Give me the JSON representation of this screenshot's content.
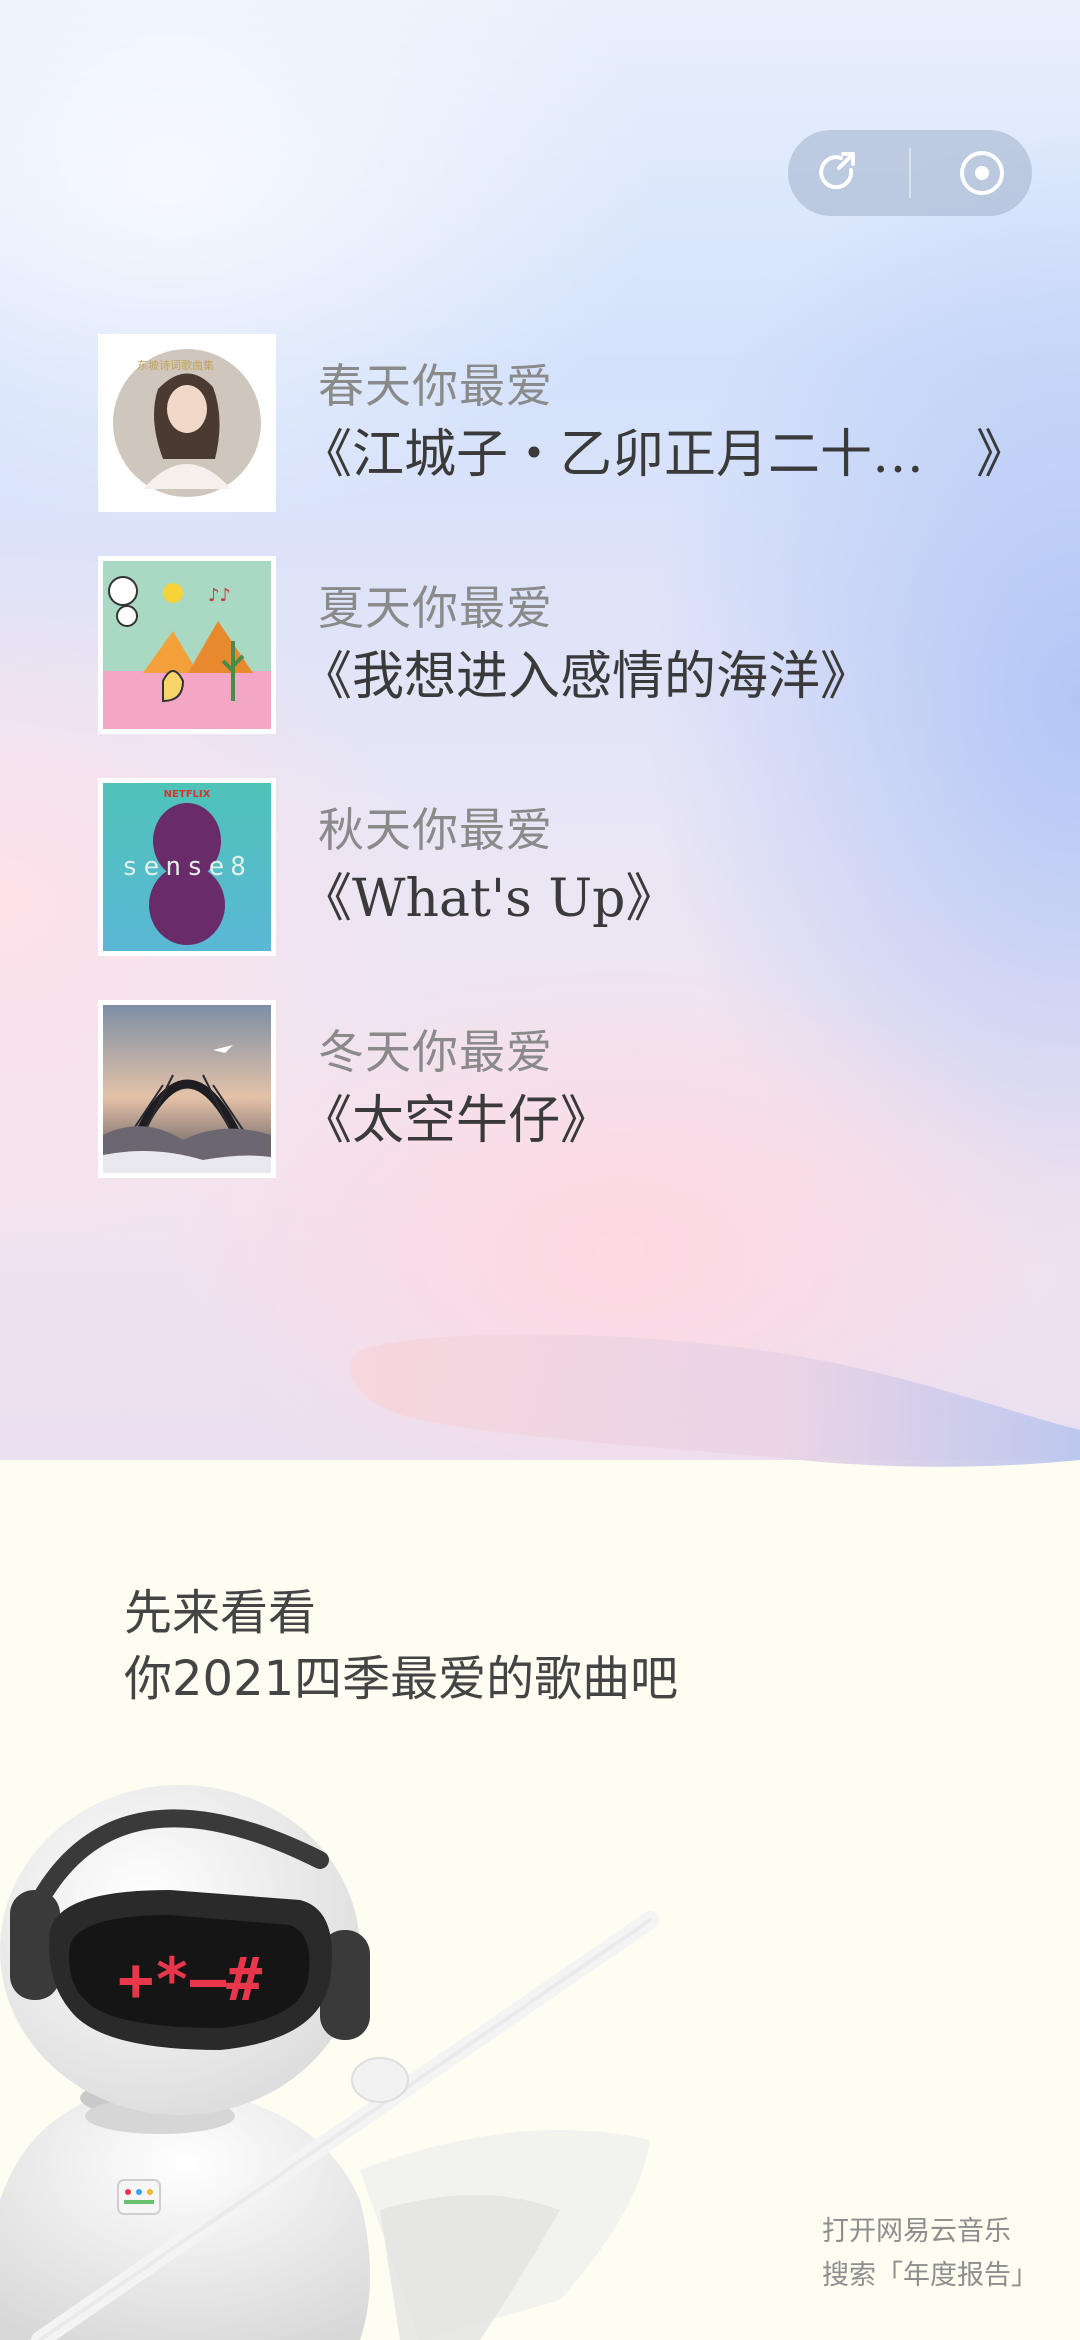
{
  "header": {
    "share_icon": "share-icon",
    "close_icon": "record-icon"
  },
  "songs": [
    {
      "season": "春天你最爱",
      "title": "《江城子・乙卯正月二十…　》",
      "cover_icon": "album-cover-spring"
    },
    {
      "season": "夏天你最爱",
      "title": "《我想进入感情的海洋》",
      "cover_icon": "album-cover-summer"
    },
    {
      "season": "秋天你最爱",
      "title": "《What's Up》",
      "cover_icon": "album-cover-autumn"
    },
    {
      "season": "冬天你最爱",
      "title": "《太空牛仔》",
      "cover_icon": "album-cover-winter"
    }
  ],
  "cover_text": {
    "spring_badge": "东坡诗词歌曲集",
    "autumn_label": "NETFLIX",
    "autumn_word": "sense8"
  },
  "intro": {
    "line1": "先来看看",
    "line2": "你2021四季最爱的歌曲吧"
  },
  "robot": {
    "visor_text": "+*—#"
  },
  "footer": {
    "line1": "打开网易云音乐",
    "line2": "搜索「年度报告」"
  },
  "colors": {
    "accent_red": "#e8364a",
    "text_dark": "#3a3a3a",
    "text_gray": "#8a8a8a",
    "cream": "#fefdf2"
  }
}
